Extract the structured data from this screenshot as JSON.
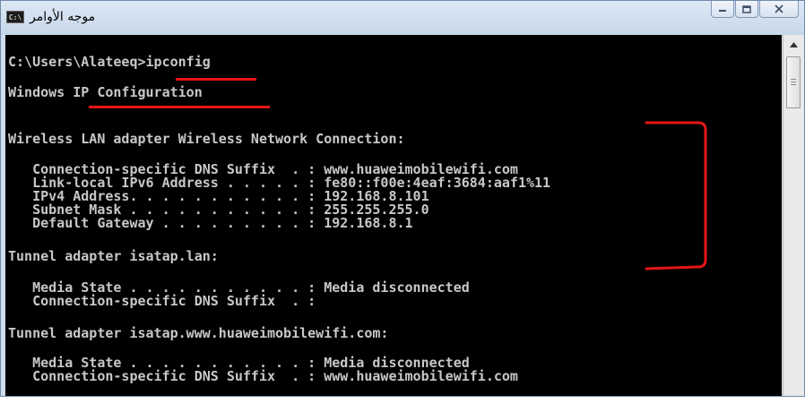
{
  "window": {
    "title": "موجه الأوامر",
    "icon_label": "C:\\",
    "caption": {
      "minimize": "minimize-icon",
      "maximize": "maximize-icon",
      "close": "close-icon"
    }
  },
  "console": {
    "lines": [
      "C:\\Users\\Alateeq>ipconfig",
      "Windows IP Configuration",
      "Wireless LAN adapter Wireless Network Connection:",
      "   Connection-specific DNS Suffix  . : www.huaweimobilewifi.com",
      "   Link-local IPv6 Address . . . . . : fe80::f00e:4eaf:3684:aaf1%11",
      "   IPv4 Address. . . . . . . . . . . : 192.168.8.101",
      "   Subnet Mask . . . . . . . . . . . : 255.255.255.0",
      "   Default Gateway . . . . . . . . . : 192.168.8.1",
      "Tunnel adapter isatap.lan:",
      "   Media State . . . . . . . . . . . : Media disconnected",
      "   Connection-specific DNS Suffix  . :",
      "Tunnel adapter isatap.www.huaweimobilewifi.com:",
      "   Media State . . . . . . . . . . . : Media disconnected",
      "   Connection-specific DNS Suffix  . : www.huaweimobilewifi.com"
    ]
  },
  "annotations": {
    "color": "#e51616"
  },
  "scrollbar": {
    "up": "arrow-up-icon",
    "down": "arrow-down-icon"
  }
}
